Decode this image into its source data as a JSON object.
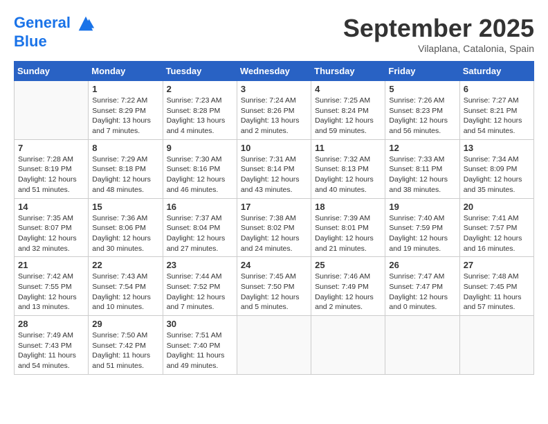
{
  "logo": {
    "line1": "General",
    "line2": "Blue"
  },
  "title": "September 2025",
  "subtitle": "Vilaplana, Catalonia, Spain",
  "weekdays": [
    "Sunday",
    "Monday",
    "Tuesday",
    "Wednesday",
    "Thursday",
    "Friday",
    "Saturday"
  ],
  "weeks": [
    [
      {
        "day": "",
        "info": ""
      },
      {
        "day": "1",
        "info": "Sunrise: 7:22 AM\nSunset: 8:29 PM\nDaylight: 13 hours\nand 7 minutes."
      },
      {
        "day": "2",
        "info": "Sunrise: 7:23 AM\nSunset: 8:28 PM\nDaylight: 13 hours\nand 4 minutes."
      },
      {
        "day": "3",
        "info": "Sunrise: 7:24 AM\nSunset: 8:26 PM\nDaylight: 13 hours\nand 2 minutes."
      },
      {
        "day": "4",
        "info": "Sunrise: 7:25 AM\nSunset: 8:24 PM\nDaylight: 12 hours\nand 59 minutes."
      },
      {
        "day": "5",
        "info": "Sunrise: 7:26 AM\nSunset: 8:23 PM\nDaylight: 12 hours\nand 56 minutes."
      },
      {
        "day": "6",
        "info": "Sunrise: 7:27 AM\nSunset: 8:21 PM\nDaylight: 12 hours\nand 54 minutes."
      }
    ],
    [
      {
        "day": "7",
        "info": "Sunrise: 7:28 AM\nSunset: 8:19 PM\nDaylight: 12 hours\nand 51 minutes."
      },
      {
        "day": "8",
        "info": "Sunrise: 7:29 AM\nSunset: 8:18 PM\nDaylight: 12 hours\nand 48 minutes."
      },
      {
        "day": "9",
        "info": "Sunrise: 7:30 AM\nSunset: 8:16 PM\nDaylight: 12 hours\nand 46 minutes."
      },
      {
        "day": "10",
        "info": "Sunrise: 7:31 AM\nSunset: 8:14 PM\nDaylight: 12 hours\nand 43 minutes."
      },
      {
        "day": "11",
        "info": "Sunrise: 7:32 AM\nSunset: 8:13 PM\nDaylight: 12 hours\nand 40 minutes."
      },
      {
        "day": "12",
        "info": "Sunrise: 7:33 AM\nSunset: 8:11 PM\nDaylight: 12 hours\nand 38 minutes."
      },
      {
        "day": "13",
        "info": "Sunrise: 7:34 AM\nSunset: 8:09 PM\nDaylight: 12 hours\nand 35 minutes."
      }
    ],
    [
      {
        "day": "14",
        "info": "Sunrise: 7:35 AM\nSunset: 8:07 PM\nDaylight: 12 hours\nand 32 minutes."
      },
      {
        "day": "15",
        "info": "Sunrise: 7:36 AM\nSunset: 8:06 PM\nDaylight: 12 hours\nand 30 minutes."
      },
      {
        "day": "16",
        "info": "Sunrise: 7:37 AM\nSunset: 8:04 PM\nDaylight: 12 hours\nand 27 minutes."
      },
      {
        "day": "17",
        "info": "Sunrise: 7:38 AM\nSunset: 8:02 PM\nDaylight: 12 hours\nand 24 minutes."
      },
      {
        "day": "18",
        "info": "Sunrise: 7:39 AM\nSunset: 8:01 PM\nDaylight: 12 hours\nand 21 minutes."
      },
      {
        "day": "19",
        "info": "Sunrise: 7:40 AM\nSunset: 7:59 PM\nDaylight: 12 hours\nand 19 minutes."
      },
      {
        "day": "20",
        "info": "Sunrise: 7:41 AM\nSunset: 7:57 PM\nDaylight: 12 hours\nand 16 minutes."
      }
    ],
    [
      {
        "day": "21",
        "info": "Sunrise: 7:42 AM\nSunset: 7:55 PM\nDaylight: 12 hours\nand 13 minutes."
      },
      {
        "day": "22",
        "info": "Sunrise: 7:43 AM\nSunset: 7:54 PM\nDaylight: 12 hours\nand 10 minutes."
      },
      {
        "day": "23",
        "info": "Sunrise: 7:44 AM\nSunset: 7:52 PM\nDaylight: 12 hours\nand 7 minutes."
      },
      {
        "day": "24",
        "info": "Sunrise: 7:45 AM\nSunset: 7:50 PM\nDaylight: 12 hours\nand 5 minutes."
      },
      {
        "day": "25",
        "info": "Sunrise: 7:46 AM\nSunset: 7:49 PM\nDaylight: 12 hours\nand 2 minutes."
      },
      {
        "day": "26",
        "info": "Sunrise: 7:47 AM\nSunset: 7:47 PM\nDaylight: 12 hours\nand 0 minutes."
      },
      {
        "day": "27",
        "info": "Sunrise: 7:48 AM\nSunset: 7:45 PM\nDaylight: 11 hours\nand 57 minutes."
      }
    ],
    [
      {
        "day": "28",
        "info": "Sunrise: 7:49 AM\nSunset: 7:43 PM\nDaylight: 11 hours\nand 54 minutes."
      },
      {
        "day": "29",
        "info": "Sunrise: 7:50 AM\nSunset: 7:42 PM\nDaylight: 11 hours\nand 51 minutes."
      },
      {
        "day": "30",
        "info": "Sunrise: 7:51 AM\nSunset: 7:40 PM\nDaylight: 11 hours\nand 49 minutes."
      },
      {
        "day": "",
        "info": ""
      },
      {
        "day": "",
        "info": ""
      },
      {
        "day": "",
        "info": ""
      },
      {
        "day": "",
        "info": ""
      }
    ]
  ]
}
